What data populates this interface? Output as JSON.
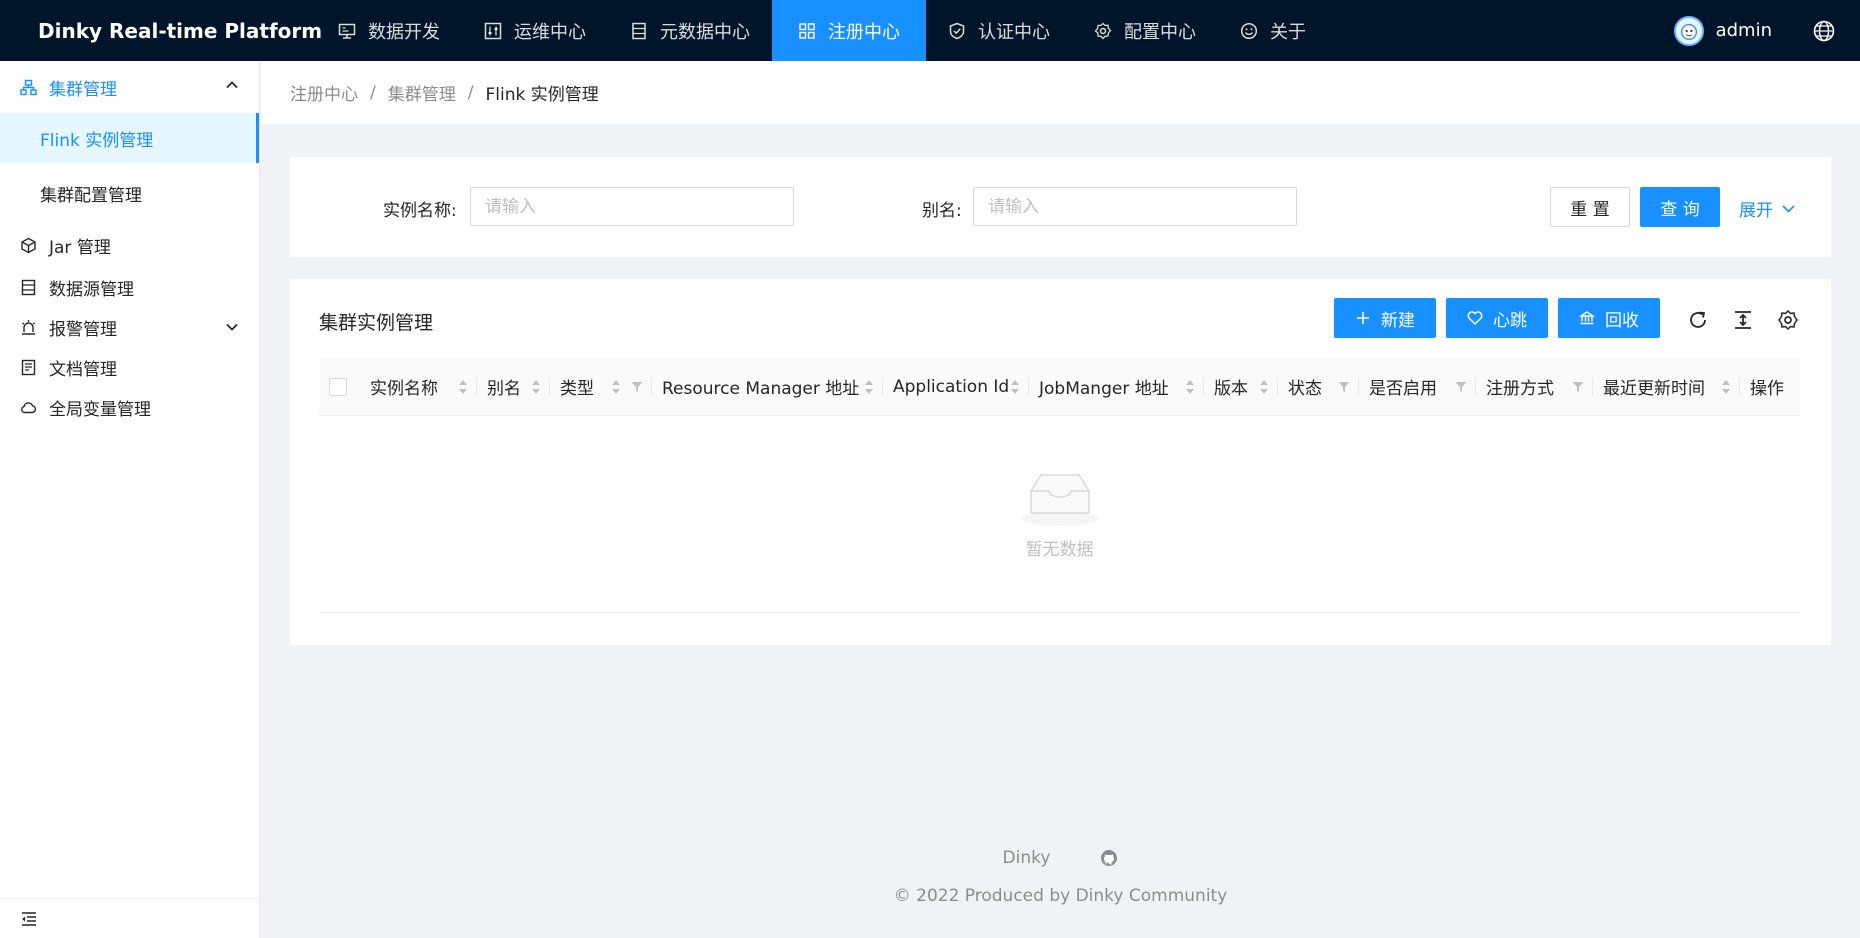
{
  "header": {
    "title": "Dinky Real-time Platform",
    "nav": [
      {
        "label": "数据开发",
        "icon": "desktop-icon"
      },
      {
        "label": "运维中心",
        "icon": "control-icon"
      },
      {
        "label": "元数据中心",
        "icon": "database-icon"
      },
      {
        "label": "注册中心",
        "icon": "appstore-icon",
        "active": true
      },
      {
        "label": "认证中心",
        "icon": "safety-icon"
      },
      {
        "label": "配置中心",
        "icon": "setting-icon"
      },
      {
        "label": "关于",
        "icon": "smile-icon"
      }
    ],
    "user": "admin"
  },
  "sidebar": {
    "group_open": "集群管理",
    "sub_items": [
      "Flink 实例管理",
      "集群配置管理"
    ],
    "items": [
      "Jar 管理",
      "数据源管理",
      "报警管理",
      "文档管理",
      "全局变量管理"
    ]
  },
  "breadcrumb": [
    "注册中心",
    "集群管理",
    "Flink 实例管理"
  ],
  "search": {
    "name_label": "实例名称:",
    "name_placeholder": "请输入",
    "alias_label": "别名:",
    "alias_placeholder": "请输入",
    "reset": "重 置",
    "query": "查 询",
    "expand": "展开"
  },
  "table": {
    "title": "集群实例管理",
    "buttons": {
      "new": "新建",
      "heartbeat": "心跳",
      "recycle": "回收"
    },
    "columns": [
      "实例名称",
      "别名",
      "类型",
      "Resource Manager 地址",
      "Application Id",
      "JobManger 地址",
      "版本",
      "状态",
      "是否启用",
      "注册方式",
      "最近更新时间",
      "操作"
    ],
    "empty_text": "暂无数据"
  },
  "footer": {
    "link": "Dinky",
    "copyright": "2022 Produced by Dinky Community"
  },
  "colors": {
    "primary": "#1890ff",
    "header_bg": "#001529",
    "page_bg": "#f0f2f5"
  }
}
